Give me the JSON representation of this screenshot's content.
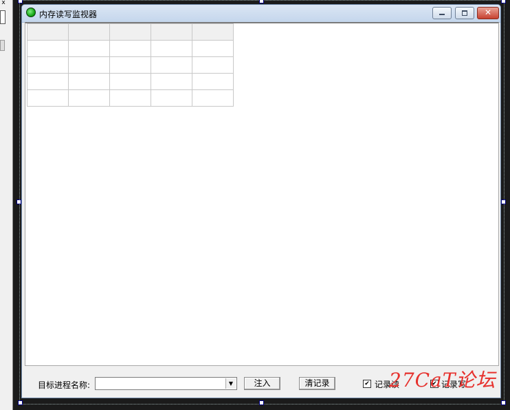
{
  "window": {
    "title": "内存读写监视器"
  },
  "grid": {
    "rows": 5,
    "cols": 5
  },
  "controls": {
    "target_label": "目标进程名称:",
    "target_value": "",
    "inject_label": "注入",
    "clear_label": "清记录",
    "record_read_label": "记录读",
    "record_read_checked": true,
    "record_write_label": "记录写",
    "record_write_checked": true
  },
  "left_panel": {
    "close_glyph": "x"
  },
  "watermark": "27CaT论坛",
  "colors": {
    "title_gradient": "#c4d6ec",
    "close_red": "#c7412f",
    "watermark_red": "#e6302c"
  }
}
